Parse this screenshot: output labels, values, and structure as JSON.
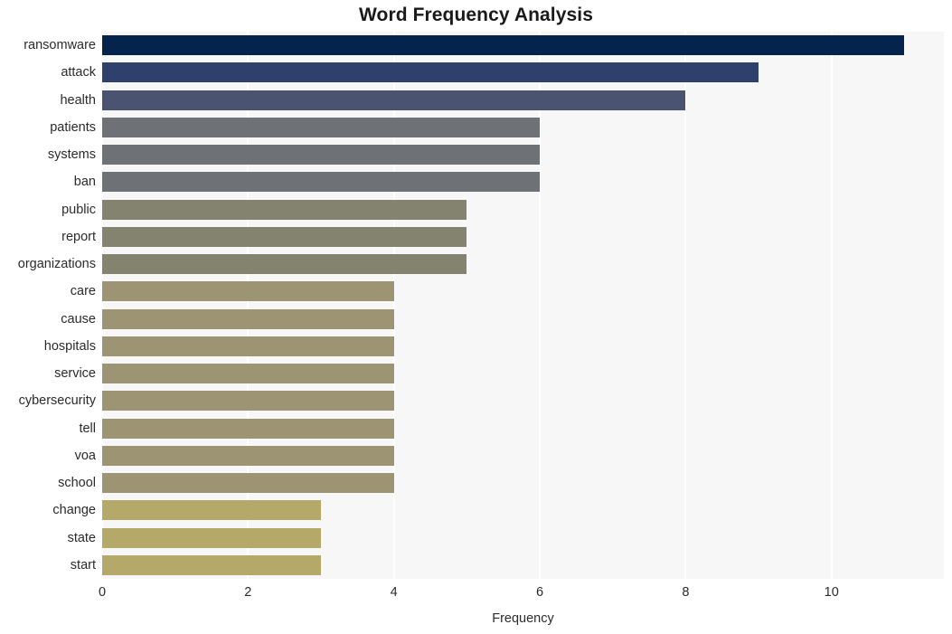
{
  "chart_data": {
    "type": "bar",
    "orientation": "horizontal",
    "title": "Word Frequency Analysis",
    "xlabel": "Frequency",
    "ylabel": "",
    "xlim": [
      0,
      11.54
    ],
    "xticks": [
      0,
      2,
      4,
      6,
      8,
      10
    ],
    "xtick_labels": [
      "0",
      "2",
      "4",
      "6",
      "8",
      "10"
    ],
    "grid": "vertical-white",
    "legend": "none",
    "plot_background": "#f7f7f7",
    "figure_background": "#ffffff",
    "categories": [
      "ransomware",
      "attack",
      "health",
      "patients",
      "systems",
      "ban",
      "public",
      "report",
      "organizations",
      "care",
      "cause",
      "hospitals",
      "service",
      "cybersecurity",
      "tell",
      "voa",
      "school",
      "change",
      "state",
      "start"
    ],
    "values": [
      11,
      9,
      8,
      6,
      6,
      6,
      5,
      5,
      5,
      4,
      4,
      4,
      4,
      4,
      4,
      4,
      4,
      3,
      3,
      3
    ],
    "bar_colors": [
      "#04234d",
      "#2f406c",
      "#4a5470",
      "#6e7175",
      "#6e7175",
      "#6e7175",
      "#84836f",
      "#84836f",
      "#84836f",
      "#9d9473",
      "#9d9473",
      "#9d9473",
      "#9d9473",
      "#9d9473",
      "#9d9473",
      "#9d9473",
      "#9d9473",
      "#b5a969",
      "#b5a969",
      "#b5a969"
    ]
  }
}
